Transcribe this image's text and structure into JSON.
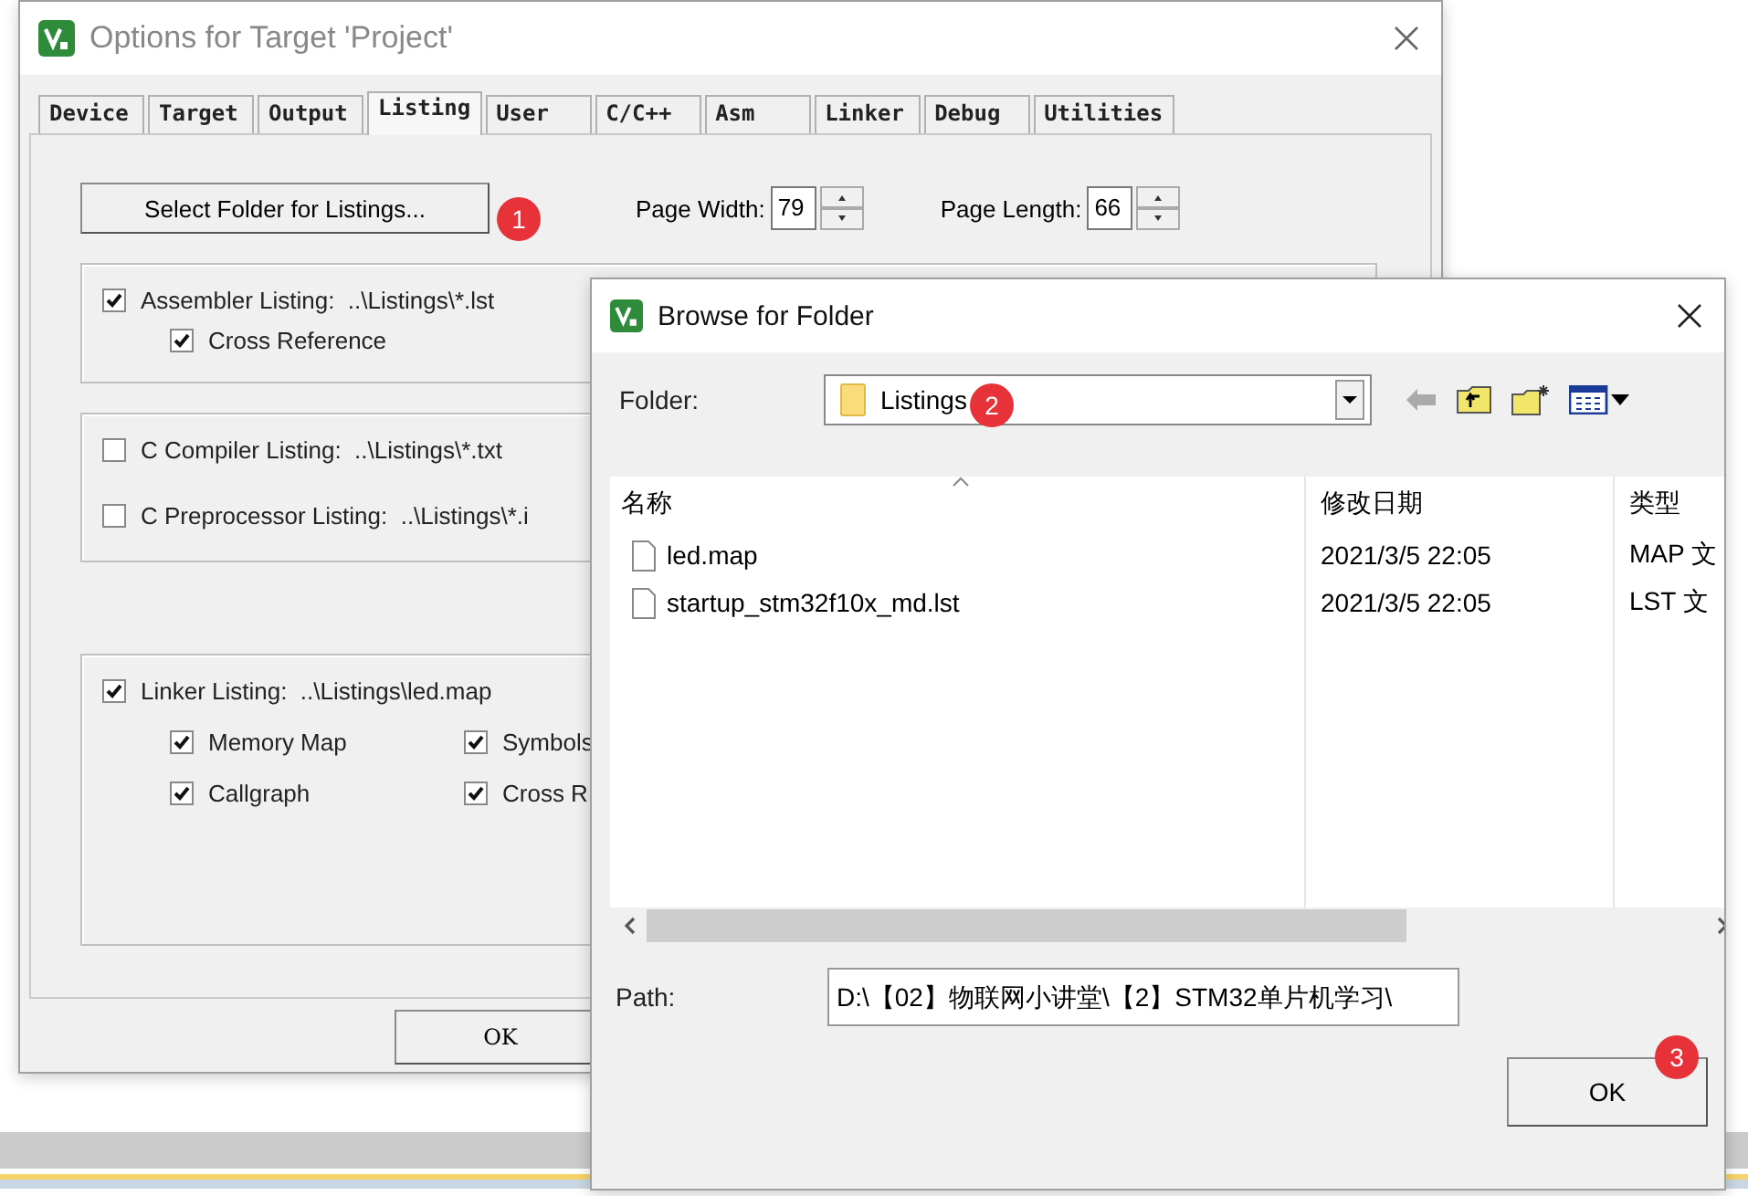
{
  "options_dialog": {
    "title": "Options for Target 'Project'",
    "tabs": [
      {
        "label": "Device",
        "selected": false
      },
      {
        "label": "Target",
        "selected": false
      },
      {
        "label": "Output",
        "selected": false
      },
      {
        "label": "Listing",
        "selected": true
      },
      {
        "label": "User",
        "selected": false
      },
      {
        "label": "C/C++",
        "selected": false
      },
      {
        "label": "Asm",
        "selected": false
      },
      {
        "label": "Linker",
        "selected": false
      },
      {
        "label": "Debug",
        "selected": false
      },
      {
        "label": "Utilities",
        "selected": false
      }
    ],
    "select_folder": {
      "label": "Select Folder for Listings...",
      "callout": "1"
    },
    "page_width": {
      "label": "Page Width:",
      "value": "79"
    },
    "page_length": {
      "label": "Page Length:",
      "value": "66"
    },
    "groups": [
      {
        "items": [
          {
            "label": "Assembler Listing:  ..\\Listings\\*.lst",
            "checked": true,
            "children": [
              {
                "label": "Cross Reference",
                "checked": true
              }
            ]
          }
        ]
      },
      {
        "items": [
          {
            "label": "C Compiler Listing:  ..\\Listings\\*.txt",
            "checked": false
          },
          {
            "label": "C Preprocessor Listing:  ..\\Listings\\*.i",
            "checked": false
          }
        ]
      },
      {
        "items": [
          {
            "label": "Linker Listing:  ..\\Listings\\led.map",
            "checked": true,
            "children": [
              {
                "label": "Memory Map",
                "checked": true
              },
              {
                "label": "Symbols",
                "checked": true
              },
              {
                "label": "Callgraph",
                "checked": true
              },
              {
                "label": "Cross R",
                "checked": true
              }
            ]
          }
        ]
      }
    ],
    "ok_button": "OK"
  },
  "browse_dialog": {
    "title": "Browse for Folder",
    "folder_label": "Folder:",
    "folder_value": "Listings",
    "folder_callout": "2",
    "columns": [
      "名称",
      "修改日期",
      "类型"
    ],
    "files": [
      {
        "name": "led.map",
        "modified": "2021/3/5 22:05",
        "type": "MAP 文"
      },
      {
        "name": "startup_stm32f10x_md.lst",
        "modified": "2021/3/5 22:05",
        "type": "LST 文"
      }
    ],
    "path_label": "Path:",
    "path_value": "D:\\【02】物联网小讲堂\\【2】STM32单片机学习\\",
    "ok_button": "OK",
    "ok_callout": "3"
  }
}
